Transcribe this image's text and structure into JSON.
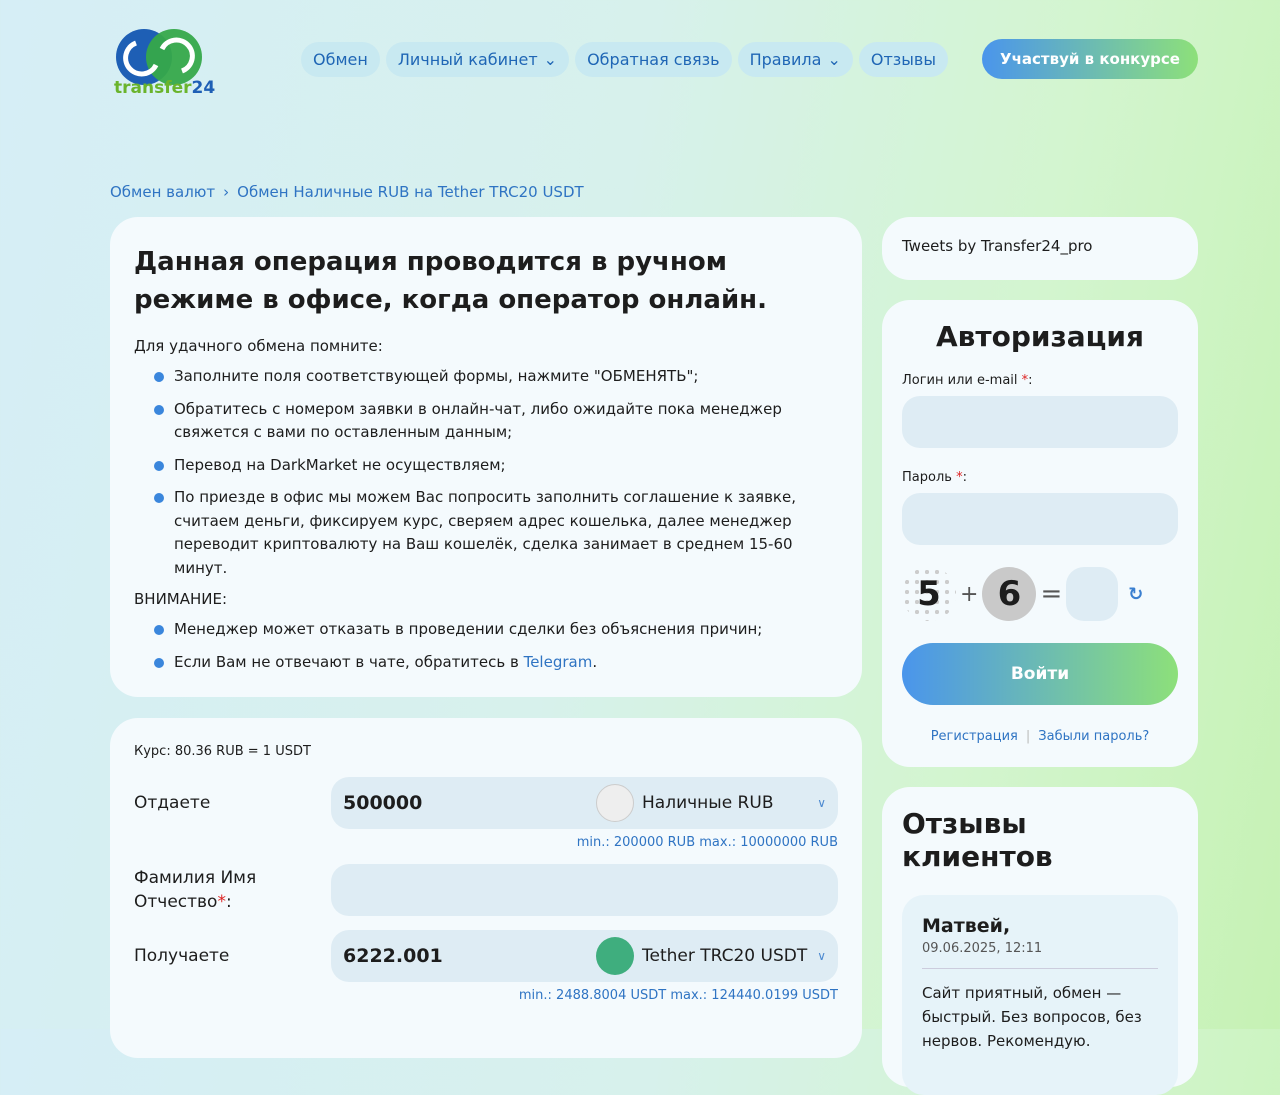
{
  "logo": {
    "text_a": "transfer",
    "text_b": "24"
  },
  "nav": [
    {
      "label": "Обмен",
      "dd": false
    },
    {
      "label": "Личный кабинет",
      "dd": true
    },
    {
      "label": "Обратная связь",
      "dd": false
    },
    {
      "label": "Правила",
      "dd": true
    },
    {
      "label": "Отзывы",
      "dd": false
    }
  ],
  "cta": "Участвуй в конкурсе",
  "breadcrumb": [
    "Обмен валют",
    "Обмен Наличные RUB на Tether TRC20 USDT"
  ],
  "info": {
    "title": "Данная операция проводится в ручном режиме в офисе, когда оператор онлайн.",
    "intro": "Для удачного обмена помните:",
    "items": [
      "Заполните поля соответствующей формы, нажмите \"ОБМЕНЯТЬ\";",
      "Обратитесь с номером заявки в онлайн-чат, либо ожидайте пока менеджер свяжется с вами по оставленным данным;",
      "Перевод на DarkMarket не осуществляем;",
      "По приезде в офис мы можем Вас попросить заполнить соглашение к заявке, считаем деньги, фиксируем курс, сверяем адрес кошелька, далее менеджер переводит криптовалюту на Ваш кошелёк, сделка занимает в среднем 15-60 минут."
    ],
    "warning": "ВНИМАНИЕ:",
    "warn_items": [
      "Менеджер может отказать в проведении сделки без объяснения причин;"
    ],
    "telegram_pre": "Если Вам не отвечают в чате, обратитесь в ",
    "telegram": "Telegram",
    "telegram_post": "."
  },
  "exchange": {
    "rate": "Курс: 80.36 RUB = 1 USDT",
    "give_label": "Отдаете",
    "give_value": "500000",
    "give_currency": "Наличные RUB",
    "give_limits": "min.: 200000 RUB  max.: 10000000 RUB",
    "name_label": "Фамилия Имя Отчество",
    "name_req": "*",
    ":": ":",
    "get_label": "Получаете",
    "get_value": "6222.001",
    "get_currency": "Tether TRC20 USDT",
    "get_limits": "min.: 2488.8004 USDT  max.: 124440.0199 USDT"
  },
  "tweets": "Tweets by Transfer24_pro",
  "auth": {
    "title": "Авторизация",
    "login_label": "Логин или e-mail ",
    "pass_label": "Пароль ",
    "req": "*",
    "colon": ":",
    "cap_a": "5",
    "plus": "+",
    "cap_b": "6",
    "eq": "=",
    "submit": "Войти",
    "register": "Регистрация",
    "sep": "|",
    "forgot": "Забыли пароль?"
  },
  "reviews": {
    "title": "Отзывы клиентов",
    "name": "Матвей,",
    "date": "09.06.2025, 12:11",
    "text": "Сайт приятный, обмен — быстрый. Без вопросов, без нервов. Рекомендую."
  }
}
